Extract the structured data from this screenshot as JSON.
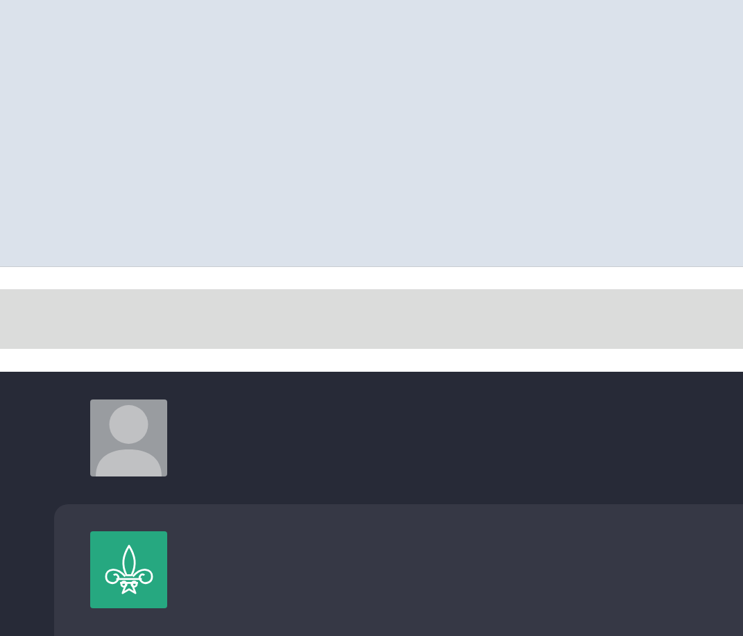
{
  "messages": [
    {
      "kind": "user"
    },
    {
      "kind": "assistant"
    }
  ]
}
